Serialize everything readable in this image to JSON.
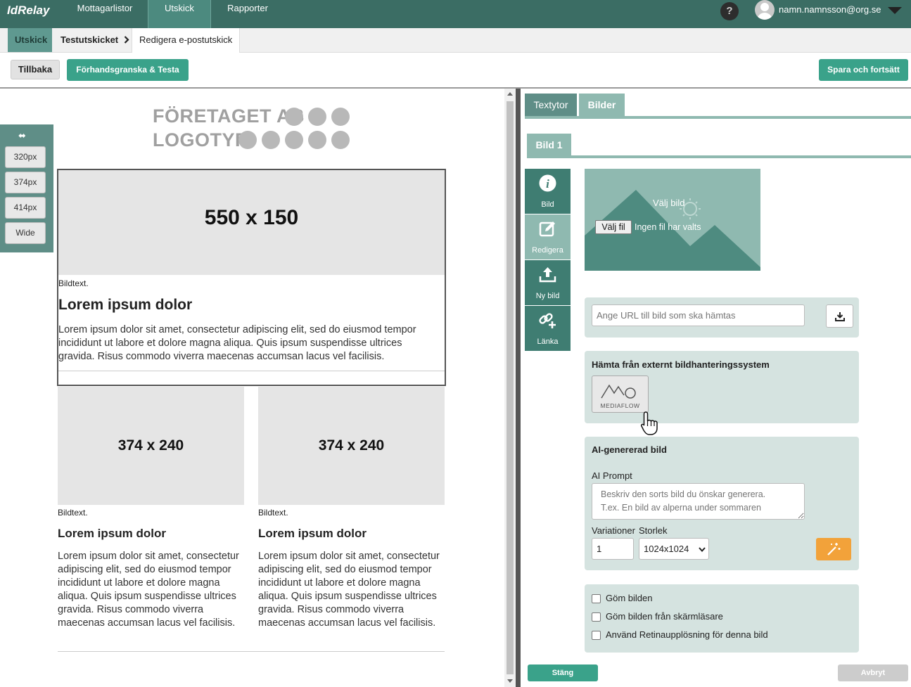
{
  "app": {
    "brand": "IdRelay"
  },
  "nav": {
    "items": [
      "Mottagarlistor",
      "Utskick",
      "Rapporter"
    ],
    "active": "Utskick"
  },
  "user": {
    "help": "?",
    "email": "namn.namnsson@org.se"
  },
  "breadcrumb": {
    "items": [
      "Utskick",
      "Testutskicket",
      "Redigera e-postutskick"
    ]
  },
  "toolbar": {
    "back_label": "Tillbaka",
    "preview_label": "Förhandsgranska & Testa",
    "save_label": "Spara och fortsätt"
  },
  "preview": {
    "logo_line1": "FÖRETAGET AB",
    "logo_line2": "LOGOTYP",
    "widths": [
      "320px",
      "374px",
      "414px",
      "Wide"
    ],
    "hero": {
      "placeholder": "550 x 150",
      "caption": "Bildtext.",
      "title": "Lorem ipsum dolor",
      "body": "Lorem ipsum dolor sit amet, consectetur adipiscing elit, sed do eiusmod tempor incididunt ut labore et dolore magna aliqua. Quis ipsum suspendisse ultrices gravida. Risus commodo viverra maecenas accumsan lacus vel facilisis."
    },
    "columns": [
      {
        "placeholder": "374 x 240",
        "caption": "Bildtext.",
        "title": "Lorem ipsum dolor",
        "body": "Lorem ipsum dolor sit amet, consectetur adipiscing elit, sed do eiusmod tempor incididunt ut labore et dolore magna aliqua. Quis ipsum suspendisse ultrices gravida. Risus commodo viverra maecenas accumsan lacus vel facilisis."
      },
      {
        "placeholder": "374 x 240",
        "caption": "Bildtext.",
        "title": "Lorem ipsum dolor",
        "body": "Lorem ipsum dolor sit amet, consectetur adipiscing elit, sed do eiusmod tempor incididunt ut labore et dolore magna aliqua. Quis ipsum suspendisse ultrices gravida. Risus commodo viverra maecenas accumsan lacus vel facilisis."
      }
    ]
  },
  "editor": {
    "tabs": [
      "Textytor",
      "Bilder"
    ],
    "active_tab": "Textytor",
    "subtab": "Bild 1",
    "tools": [
      "Bild",
      "Redigera",
      "Ny bild",
      "Länka"
    ],
    "selected_tool": "Redigera",
    "image": {
      "choose_label": "Välj bild",
      "file_button": "Välj fil",
      "no_file": "Ingen fil har valts"
    },
    "url": {
      "placeholder": "Ange URL till bild som ska hämtas"
    },
    "external": {
      "title": "Hämta från externt bildhanteringssystem",
      "provider": "MEDIAFLOW"
    },
    "ai": {
      "title": "AI-genererad bild",
      "prompt_label": "AI Prompt",
      "prompt_placeholder": "Beskriv den sorts bild du önskar generera.\nT.ex. En bild av alperna under sommaren",
      "variations_label": "Variationer",
      "size_label": "Storlek",
      "variations_value": "1",
      "size_value": "1024x1024"
    },
    "options": [
      "Göm bilden",
      "Göm bilden från skärmläsare",
      "Använd Retinaupplösning för denna bild"
    ],
    "close_label": "Stäng",
    "cancel_label": "Avbryt"
  },
  "colors": {
    "topbar": "#3b6d64",
    "accent": "#3aa28a",
    "panel": "#d5e3e0",
    "ai_button": "#f2a23a"
  }
}
